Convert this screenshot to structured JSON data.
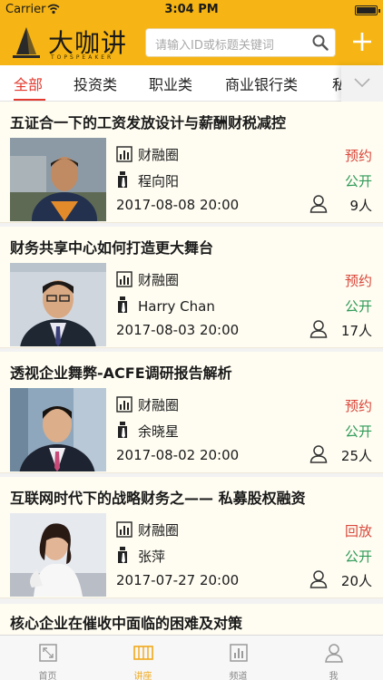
{
  "status_bar": {
    "carrier": "Carrier",
    "time": "3:04 PM"
  },
  "header": {
    "logo_text": "大咖讲",
    "logo_sub": "TOPSPEAKER",
    "search_placeholder": "请输入ID或标题关键词"
  },
  "tabs": [
    {
      "label": "全部",
      "active": true
    },
    {
      "label": "投资类",
      "active": false
    },
    {
      "label": "职业类",
      "active": false
    },
    {
      "label": "商业银行类",
      "active": false
    },
    {
      "label": "私",
      "active": false
    }
  ],
  "lectures": [
    {
      "title": "五证合一下的工资发放设计与薪酬财税减控",
      "channel": "财融圈",
      "speaker": "程向阳",
      "datetime": "2017-08-08 20:00",
      "status": "预约",
      "access": "公开",
      "count": "9人"
    },
    {
      "title": "财务共享中心如何打造更大舞台",
      "channel": "财融圈",
      "speaker": "Harry Chan",
      "datetime": "2017-08-03 20:00",
      "status": "预约",
      "access": "公开",
      "count": "17人"
    },
    {
      "title": "透视企业舞弊-ACFE调研报告解析",
      "channel": "财融圈",
      "speaker": "余晓星",
      "datetime": "2017-08-02 20:00",
      "status": "预约",
      "access": "公开",
      "count": "25人"
    },
    {
      "title": "互联网时代下的战略财务之—— 私募股权融资",
      "channel": "财融圈",
      "speaker": "张萍",
      "datetime": "2017-07-27 20:00",
      "status": "回放",
      "access": "公开",
      "count": "20人"
    },
    {
      "title": "核心企业在催收中面临的困难及对策"
    }
  ],
  "bottom_nav": [
    {
      "label": "首页",
      "icon": "home-icon",
      "active": false
    },
    {
      "label": "讲座",
      "icon": "lecture-icon",
      "active": true
    },
    {
      "label": "频道",
      "icon": "channel-icon",
      "active": false
    },
    {
      "label": "我",
      "icon": "profile-icon",
      "active": false
    }
  ],
  "colors": {
    "brand": "#f6b514",
    "accent_red": "#e23a2e",
    "green": "#2f9a58",
    "card_bg": "#fffdf2"
  }
}
